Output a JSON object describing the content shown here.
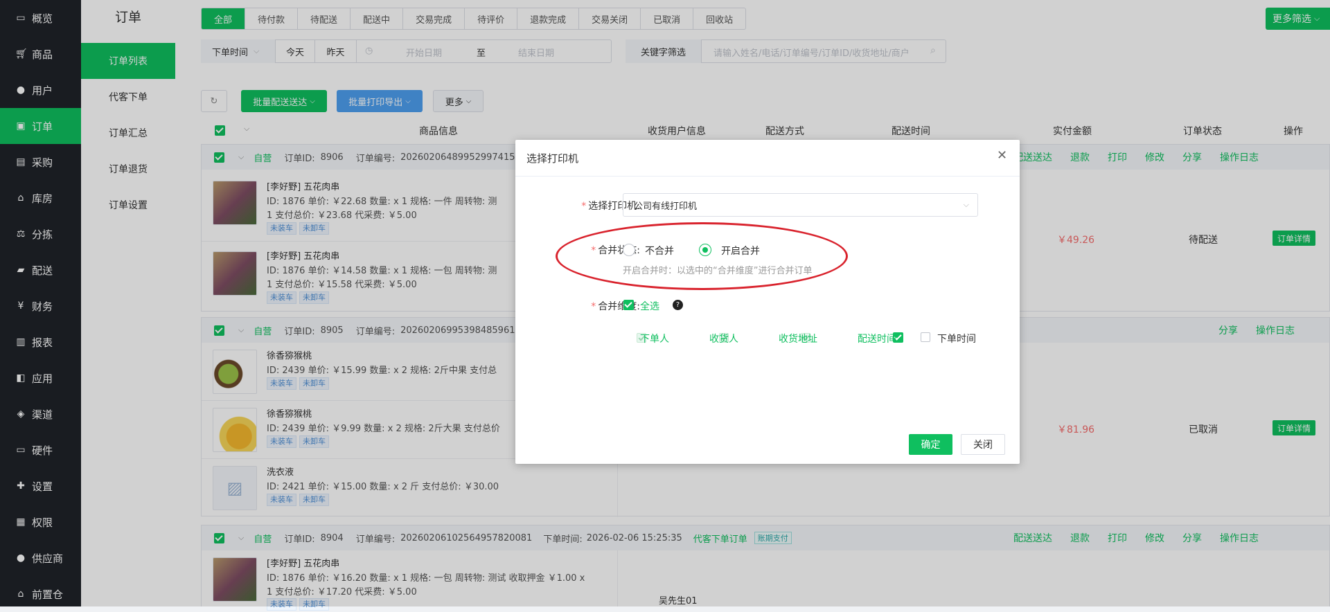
{
  "sidebar": {
    "items": [
      {
        "icon": "monitor-icon",
        "label": "概览"
      },
      {
        "icon": "cart-icon",
        "label": "商品"
      },
      {
        "icon": "users-icon",
        "label": "用户"
      },
      {
        "icon": "money-icon",
        "label": "订单",
        "active": true
      },
      {
        "icon": "truck-icon",
        "label": "采购"
      },
      {
        "icon": "home-icon",
        "label": "库房"
      },
      {
        "icon": "scale-icon",
        "label": "分拣"
      },
      {
        "icon": "delivery-icon",
        "label": "配送"
      },
      {
        "icon": "yen-icon",
        "label": "财务"
      },
      {
        "icon": "bar-chart-icon",
        "label": "报表"
      },
      {
        "icon": "apps-icon",
        "label": "应用"
      },
      {
        "icon": "box-icon",
        "label": "渠道"
      },
      {
        "icon": "desktop-icon",
        "label": "硬件"
      },
      {
        "icon": "puzzle-icon",
        "label": "设置"
      },
      {
        "icon": "bank-icon",
        "label": "权限"
      },
      {
        "icon": "group-icon",
        "label": "供应商"
      },
      {
        "icon": "store-icon",
        "label": "前置仓"
      }
    ]
  },
  "subnav": {
    "title": "订单",
    "items": [
      "订单列表",
      "代客下单",
      "订单汇总",
      "订单退货",
      "订单设置"
    ]
  },
  "tabs": [
    "全部",
    "待付款",
    "待配送",
    "配送中",
    "交易完成",
    "待评价",
    "退款完成",
    "交易关闭",
    "已取消",
    "回收站"
  ],
  "more_filter": "更多筛选",
  "filters": {
    "time_type": "下单时间",
    "today": "今天",
    "yesterday": "昨天",
    "start_placeholder": "开始日期",
    "to": "至",
    "end_placeholder": "结束日期",
    "keyword_label": "关键字筛选",
    "keyword_placeholder": "请输入姓名/电话/订单编号/订单ID/收货地址/商户"
  },
  "toolbar": {
    "batch_delivery": "批量配送送达",
    "batch_print": "批量打印导出",
    "more": "更多"
  },
  "table": {
    "headers": [
      "商品信息",
      "收货用户信息",
      "配送方式",
      "配送时间",
      "实付金额",
      "订单状态",
      "操作"
    ]
  },
  "orders": [
    {
      "type": "自营",
      "id_label": "订单ID:",
      "id": "8906",
      "no_label": "订单编号:",
      "no": "20260206489952997415",
      "amount": "￥49.26",
      "status": "待配送",
      "detail_btn": "订单详情",
      "actions": [
        "配送送达",
        "退款",
        "打印",
        "修改",
        "分享",
        "操作日志"
      ],
      "products": [
        {
          "name": "[李好野] 五花肉串",
          "line1": "ID: 1876   单价: ￥22.68   数量: x 1   规格: 一件   周转物: 测",
          "line2": "1   支付总价: ￥23.68   代采费: ￥5.00",
          "tags": [
            "未装车",
            "未卸车"
          ]
        },
        {
          "name": "[李好野] 五花肉串",
          "line1": "ID: 1876   单价: ￥14.58   数量: x 1   规格: 一包   周转物: 测",
          "line2": "1   支付总价: ￥15.58   代采费: ￥5.00",
          "tags": [
            "未装车",
            "未卸车"
          ]
        }
      ]
    },
    {
      "type": "自营",
      "id_label": "订单ID:",
      "id": "8905",
      "no_label": "订单编号:",
      "no": "20260206995398485961",
      "amount": "￥81.96",
      "status": "已取消",
      "detail_btn": "订单详情",
      "actions": [
        "分享",
        "操作日志"
      ],
      "products": [
        {
          "name": "徐香猕猴桃",
          "line1": "ID: 2439   单价: ￥15.99   数量: x 2   规格: 2斤中果   支付总",
          "tags": [
            "未装车",
            "未卸车"
          ]
        },
        {
          "name": "徐香猕猴桃",
          "line1": "ID: 2439   单价: ￥9.99   数量: x 2   规格: 2斤大果   支付总价",
          "tags": [
            "未装车",
            "未卸车"
          ]
        },
        {
          "name": "洗衣液",
          "line1": "ID: 2421   单价: ￥15.00   数量: x 2 斤   支付总价: ￥30.00",
          "tags": [
            "未装车",
            "未卸车"
          ]
        }
      ]
    },
    {
      "type": "自营",
      "id_label": "订单ID:",
      "id": "8904",
      "no_label": "订单编号:",
      "no": "20260206102564957820081",
      "time_label": "下单时间:",
      "time": "2026-02-06 15:25:35",
      "source": "代客下单订单",
      "pay_tag": "账期支付",
      "receiver": "吴先生01",
      "actions": [
        "配送送达",
        "退款",
        "打印",
        "修改",
        "分享",
        "操作日志"
      ],
      "products": [
        {
          "name": "[李好野] 五花肉串",
          "line1": "ID: 1876   单价: ￥16.20   数量: x 1   规格: 一包   周转物: 测试 收取押金 ￥1.00 x",
          "line2": "1   支付总价: ￥17.20   代采费: ￥5.00",
          "tags": [
            "未装车",
            "未卸车"
          ]
        }
      ]
    }
  ],
  "dialog": {
    "title": "选择打印机",
    "printer_label": "选择打印机:",
    "printer_value": "公司有线打印机",
    "merge_label": "合并状态:",
    "merge_off": "不合并",
    "merge_on": "开启合并",
    "merge_hint": "开启合并时：以选中的“合并维度”进行合并订单",
    "dim_label": "合并维度:",
    "select_all": "全选",
    "dims": [
      "下单人",
      "收货人",
      "收货地址",
      "配送时间",
      "下单时间"
    ],
    "confirm": "确定",
    "close": "关闭"
  },
  "colors": {
    "accent": "#0fbf5f",
    "sidebar_bg": "#1f2329",
    "blue": "#4e9ff0",
    "price": "#f56c6c",
    "annotation": "#d9232d"
  }
}
